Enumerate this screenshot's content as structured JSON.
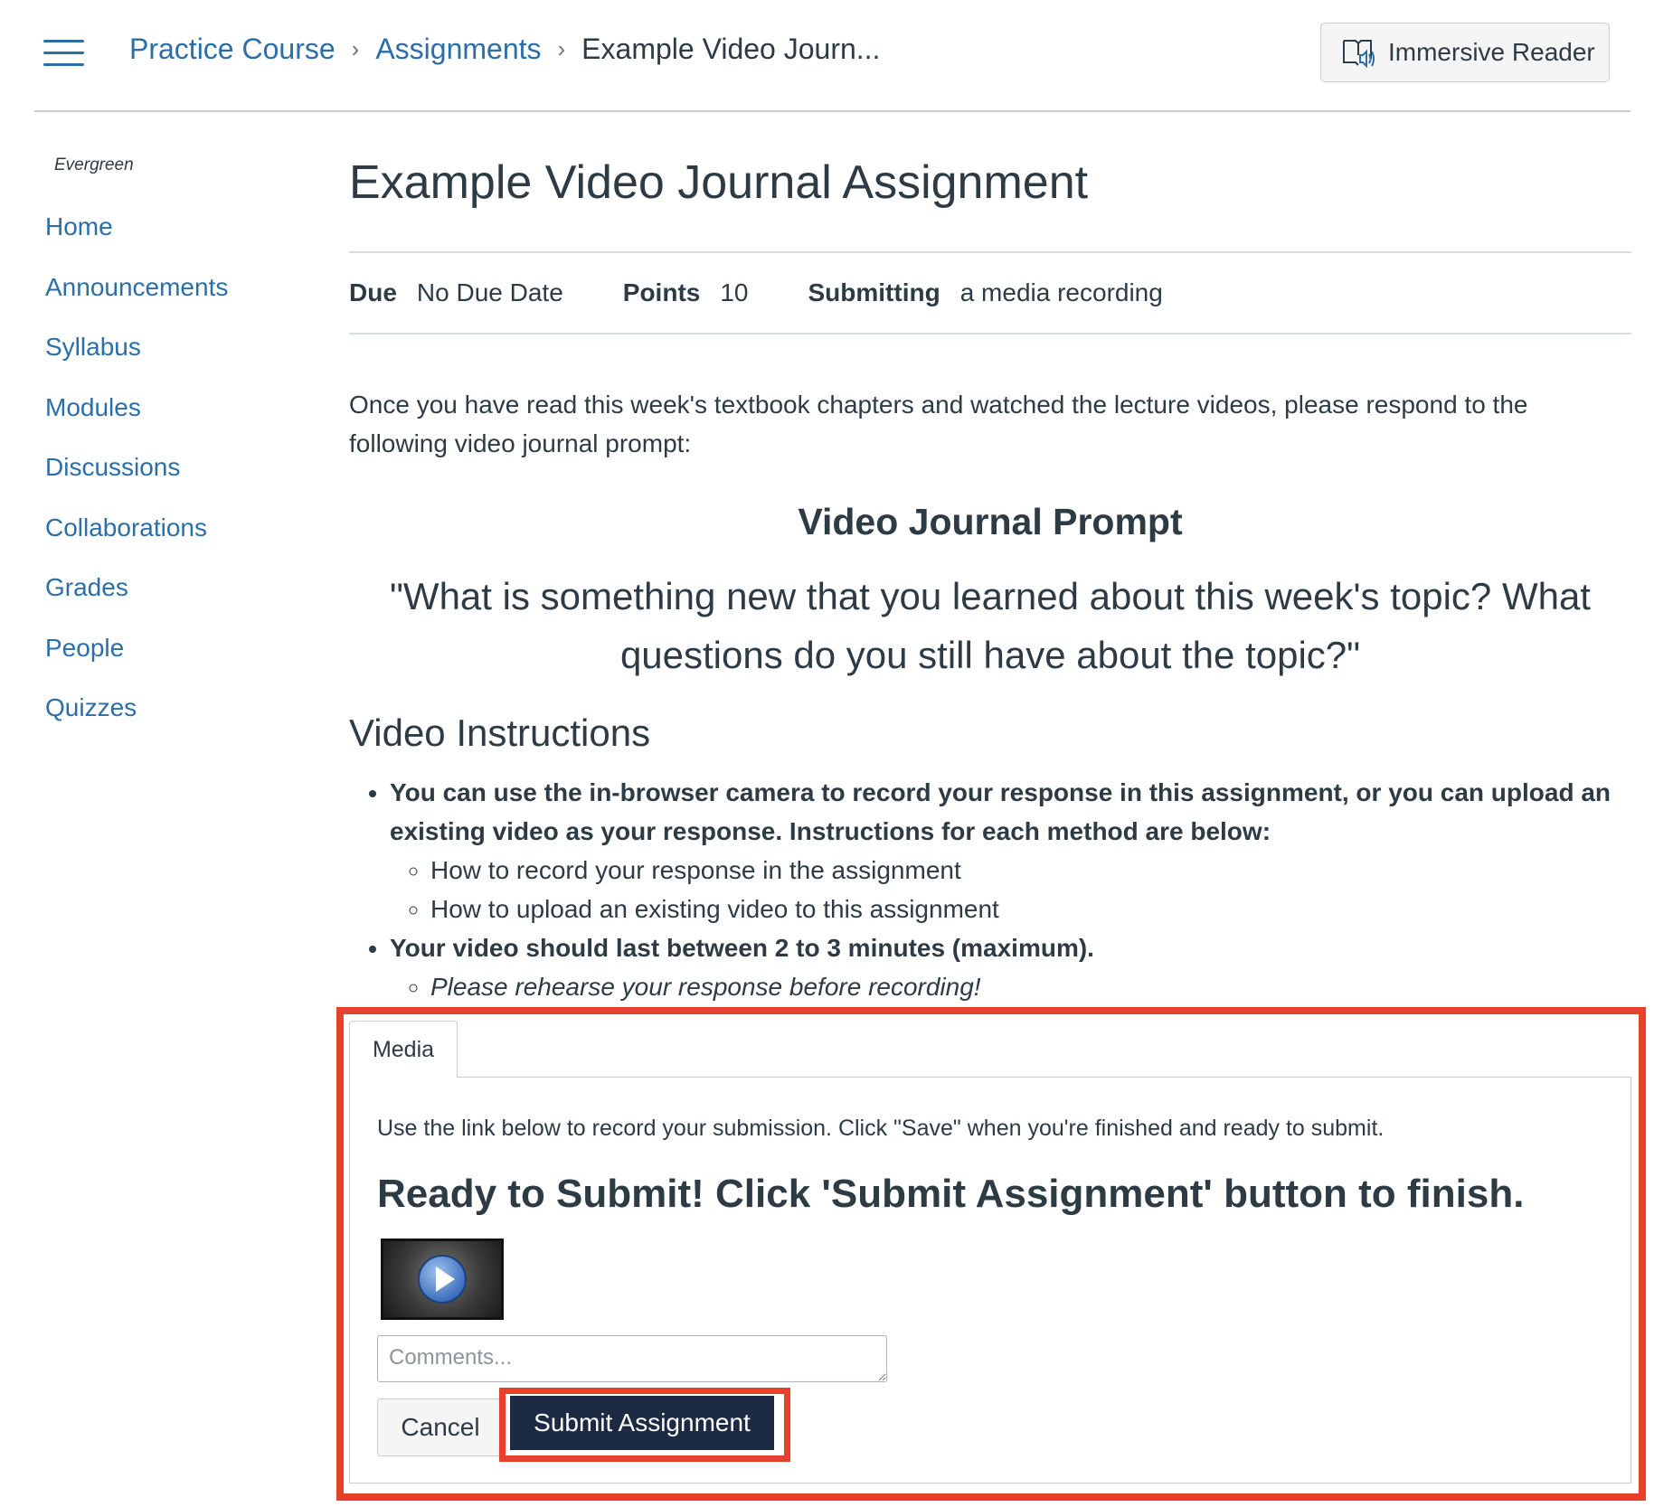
{
  "header": {
    "breadcrumbs": [
      "Practice Course",
      "Assignments",
      "Example Video Journ..."
    ],
    "separator": "›",
    "immersive_reader_label": "Immersive Reader"
  },
  "sidebar": {
    "org_name": "Evergreen",
    "items": [
      "Home",
      "Announcements",
      "Syllabus",
      "Modules",
      "Discussions",
      "Collaborations",
      "Grades",
      "People",
      "Quizzes"
    ]
  },
  "assignment": {
    "title": "Example Video Journal Assignment",
    "due_label": "Due",
    "due_value": "No Due Date",
    "points_label": "Points",
    "points_value": "10",
    "submitting_label": "Submitting",
    "submitting_value": "a media recording",
    "intro": "Once you have read this week's textbook chapters and watched the lecture videos, please respond to the following video journal prompt:",
    "prompt_heading": "Video Journal Prompt",
    "prompt_quote": "\"What is something new that you learned about this week's topic? What questions do you still have about the topic?\"",
    "instructions_heading": "Video Instructions",
    "bullet1": "You can use the in-browser camera to record your response in this assignment, or you can upload an existing video as your response. Instructions for each method are below:",
    "bullet1_sub1": "How to record your response in the assignment",
    "bullet1_sub2": "How to upload an existing video to this assignment",
    "bullet2": "Your video should last between 2 to 3 minutes (maximum).",
    "bullet2_sub1": "Please rehearse your response before recording!"
  },
  "submission": {
    "tab_label": "Media",
    "note": "Use the link below to record your submission. Click \"Save\" when you're finished and ready to submit.",
    "ready_text": "Ready to Submit! Click 'Submit Assignment' button to finish.",
    "comments_placeholder": "Comments...",
    "comments_value": "",
    "cancel_label": "Cancel",
    "submit_label": "Submit Assignment"
  },
  "colors": {
    "link": "#2b6ea8",
    "text": "#2d3b45",
    "submit_bg": "#1d2a44",
    "highlight": "#e8412b"
  },
  "icons": [
    "hamburger-menu-icon",
    "immersive-reader-icon",
    "play-icon"
  ]
}
